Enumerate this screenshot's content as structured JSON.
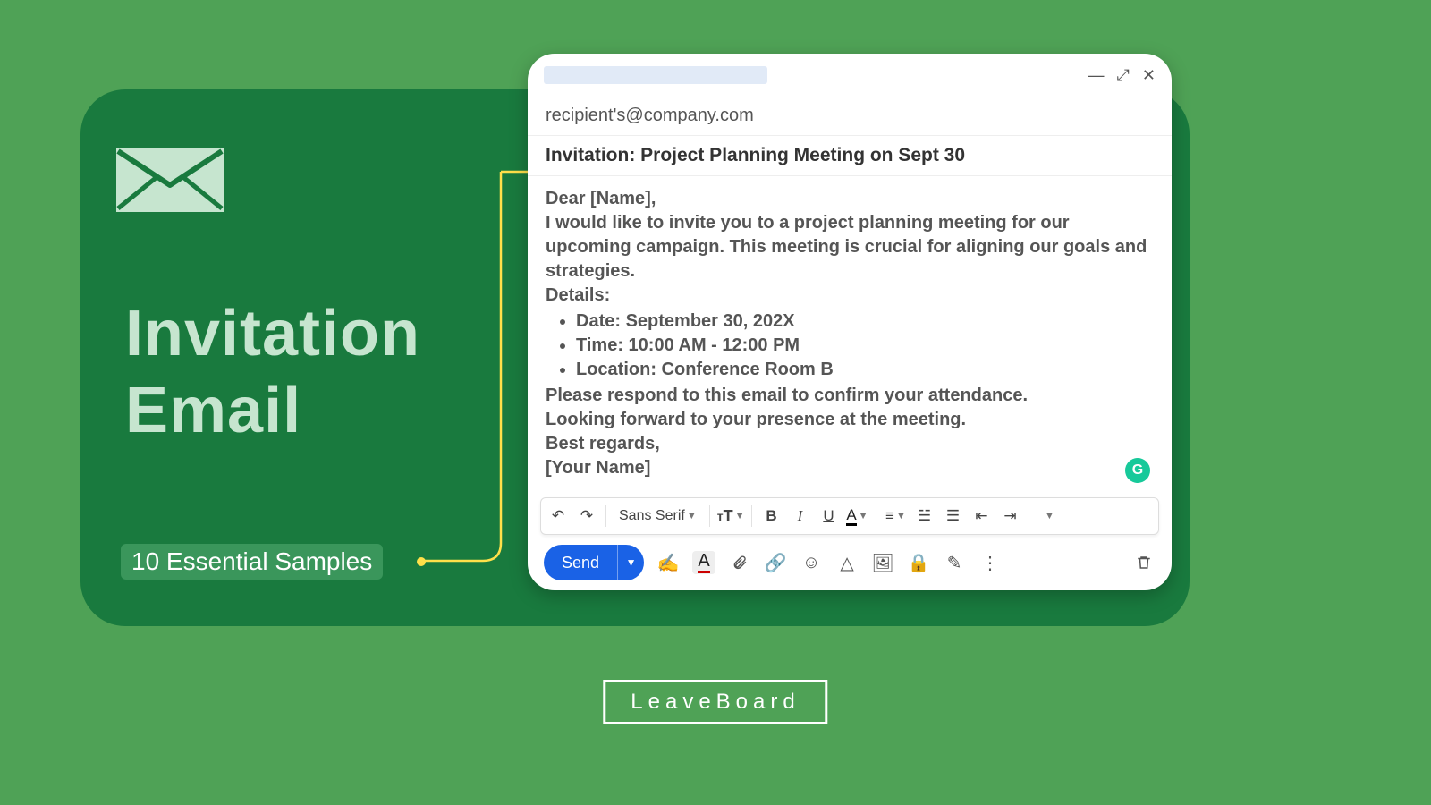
{
  "hero": {
    "title_line1": "Invitation",
    "title_line2": "Email",
    "subtitle": "10 Essential Samples"
  },
  "compose": {
    "recipient": "recipient's@company.com",
    "subject": "Invitation: Project Planning Meeting on Sept 30",
    "body": {
      "greeting": "Dear [Name],",
      "intro": "I would like to invite you to a project planning meeting for our upcoming campaign. This meeting is crucial for aligning our goals and strategies.",
      "details_label": "Details:",
      "details": {
        "date": "Date: September 30, 202X",
        "time": "Time: 10:00 AM - 12:00 PM",
        "location": "Location: Conference Room B"
      },
      "confirm": "Please respond to this email to confirm your attendance.",
      "closing1": "Looking forward to your presence at the meeting.",
      "closing2": "Best regards,",
      "signature": "[Your Name]"
    },
    "font_name": "Sans Serif",
    "send_label": "Send"
  },
  "brand": "LeaveBoard"
}
